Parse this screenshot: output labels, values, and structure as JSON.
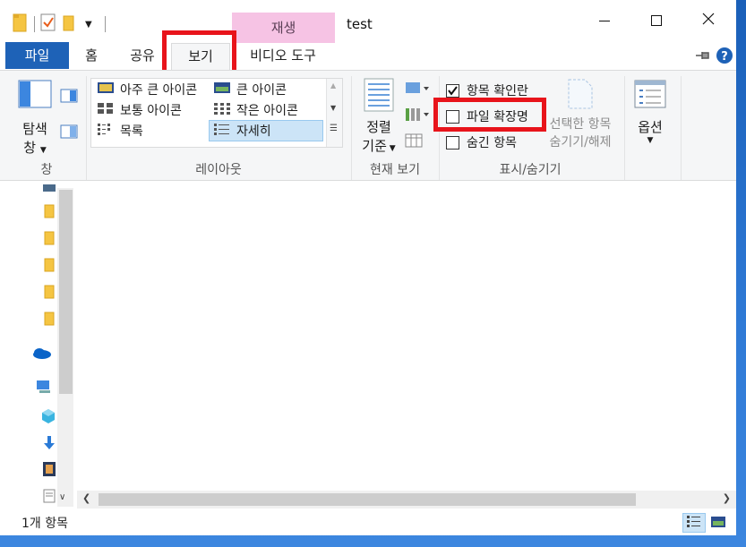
{
  "window": {
    "title": "test",
    "context_tab_label": "재생"
  },
  "tabs": {
    "file": "파일",
    "home": "홈",
    "share": "공유",
    "view": "보기",
    "video_tools": "비디오 도구"
  },
  "ribbon": {
    "pane": {
      "navigation_pane_line1": "탐색",
      "navigation_pane_line2": "창",
      "group_label": "창"
    },
    "layout": {
      "items": [
        "아주 큰 아이콘",
        "큰 아이콘",
        "보통 아이콘",
        "작은 아이콘",
        "목록",
        "자세히"
      ],
      "selected": "자세히",
      "group_label": "레이아웃"
    },
    "current_view": {
      "sort_line1": "정렬",
      "sort_line2": "기준",
      "group_label": "현재 보기"
    },
    "show_hide": {
      "item_check_boxes": {
        "label": "항목 확인란",
        "checked": true
      },
      "file_name_extensions": {
        "label": "파일 확장명",
        "checked": false
      },
      "hidden_items": {
        "label": "숨긴 항목",
        "checked": false
      },
      "hide_selected_line1": "선택한 항목",
      "hide_selected_line2": "숨기기/해제",
      "group_label": "표시/숨기기"
    },
    "options": {
      "label": "옵션"
    }
  },
  "status": {
    "item_count": "1개 항목"
  },
  "colors": {
    "accent": "#1e62b7",
    "highlight": "#e8141b",
    "context_tab": "#f6c3e4",
    "selected_bg": "#cce4f7"
  }
}
